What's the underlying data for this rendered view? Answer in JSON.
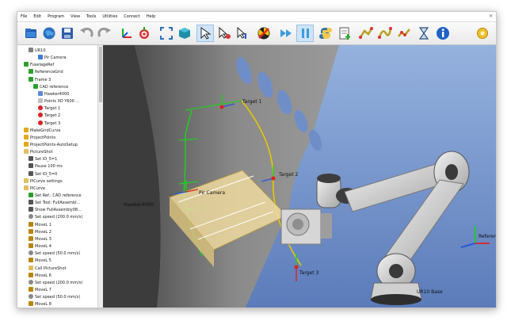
{
  "menu": [
    "File",
    "Edit",
    "Program",
    "View",
    "Tools",
    "Utilities",
    "Connect",
    "Help"
  ],
  "toolbar_icons": [
    "open-station-icon",
    "world-icon",
    "save-icon",
    "undo-icon",
    "redo-icon",
    "add-reference-frame-icon",
    "add-target-icon",
    "fit-all-icon",
    "add-object-icon",
    "select-icon",
    "select-target-icon",
    "move-target-icon",
    "stop-icon",
    "fast-forward-icon",
    "pause-icon",
    "python-icon",
    "add-program-icon",
    "robot-program-icon",
    "curve-program-icon",
    "followcurve-icon",
    "hourglass-icon",
    "info-icon",
    "settings-icon"
  ],
  "tree": [
    {
      "label": "UR10",
      "indent": 2,
      "icon": "robot",
      "color": "#7f7f7f"
    },
    {
      "label": "Pir Camera",
      "indent": 4,
      "icon": "camera",
      "color": "#3a7bd5"
    },
    {
      "label": "FuselageRef",
      "indent": 1,
      "icon": "frame",
      "color": "#2aa02a"
    },
    {
      "label": "ReferenceGrid",
      "indent": 2,
      "icon": "grid",
      "color": "#2aa02a"
    },
    {
      "label": "Frame 3",
      "indent": 2,
      "icon": "frame",
      "color": "#2aa02a"
    },
    {
      "label": "CAD reference",
      "indent": 3,
      "icon": "frame",
      "color": "#2aa02a"
    },
    {
      "label": "Hawker4000",
      "indent": 4,
      "icon": "object",
      "color": "#5a8ad5"
    },
    {
      "label": "Points XO Y600 ...",
      "indent": 4,
      "icon": "points",
      "color": "#c0c0c0"
    },
    {
      "label": "Target 1",
      "indent": 4,
      "icon": "target",
      "color": "#d22"
    },
    {
      "label": "Target 2",
      "indent": 4,
      "icon": "target",
      "color": "#d22"
    },
    {
      "label": "Target 3",
      "indent": 4,
      "icon": "target",
      "color": "#d22"
    },
    {
      "label": "MakeGridCurve",
      "indent": 1,
      "icon": "python",
      "color": "#e6a817"
    },
    {
      "label": "ProjectPoints",
      "indent": 1,
      "icon": "python",
      "color": "#e6a817"
    },
    {
      "label": "ProjectPoints-AutoSetup",
      "indent": 1,
      "icon": "python",
      "color": "#e6a817"
    },
    {
      "label": "PictureShot",
      "indent": 1,
      "icon": "program",
      "color": "#e0c060"
    },
    {
      "label": "Set IO_5=1",
      "indent": 2,
      "icon": "io",
      "color": "#555"
    },
    {
      "label": "Pause 100 ms",
      "indent": 2,
      "icon": "pause",
      "color": "#555"
    },
    {
      "label": "Set IO_5=0",
      "indent": 2,
      "icon": "io",
      "color": "#555"
    },
    {
      "label": "PiCurve settings",
      "indent": 1,
      "icon": "program",
      "color": "#e0c060"
    },
    {
      "label": "PiCurve",
      "indent": 1,
      "icon": "program",
      "color": "#e0c060"
    },
    {
      "label": "Set Ref.: CAD reference",
      "indent": 2,
      "icon": "frame",
      "color": "#2aa02a"
    },
    {
      "label": "Set Tool: FullAssembl...",
      "indent": 2,
      "icon": "tool",
      "color": "#555"
    },
    {
      "label": "Show FullAssembly08...",
      "indent": 2,
      "icon": "show",
      "color": "#555"
    },
    {
      "label": "Set speed (200.0 mm/s)",
      "indent": 2,
      "icon": "speed",
      "color": "#888"
    },
    {
      "label": "MoveL 1",
      "indent": 2,
      "icon": "move",
      "color": "#b8860b"
    },
    {
      "label": "MoveL 2",
      "indent": 2,
      "icon": "move",
      "color": "#b8860b"
    },
    {
      "label": "MoveL 3",
      "indent": 2,
      "icon": "move",
      "color": "#b8860b"
    },
    {
      "label": "MoveL 4",
      "indent": 2,
      "icon": "move",
      "color": "#b8860b"
    },
    {
      "label": "Set speed (50.0 mm/s)",
      "indent": 2,
      "icon": "speed",
      "color": "#888"
    },
    {
      "label": "MoveL 5",
      "indent": 2,
      "icon": "move",
      "color": "#b8860b"
    },
    {
      "label": "Call PictureShot",
      "indent": 2,
      "icon": "call",
      "color": "#e0c060"
    },
    {
      "label": "MoveL 6",
      "indent": 2,
      "icon": "move",
      "color": "#b8860b"
    },
    {
      "label": "Set speed (200.0 mm/s)",
      "indent": 2,
      "icon": "speed",
      "color": "#888"
    },
    {
      "label": "MoveL 7",
      "indent": 2,
      "icon": "move",
      "color": "#b8860b"
    },
    {
      "label": "Set speed (50.0 mm/s)",
      "indent": 2,
      "icon": "speed",
      "color": "#888"
    },
    {
      "label": "MoveL 8",
      "indent": 2,
      "icon": "move",
      "color": "#b8860b"
    }
  ],
  "scene": {
    "target1_label": "Target 1",
    "target2_label": "Target 2",
    "target3_label": "Target 3",
    "hawker_label": "Hawker4000",
    "camera_label": "Pir Camera",
    "refgrid_label": "ReferenceGrid",
    "base_label": "UR10 Base"
  }
}
